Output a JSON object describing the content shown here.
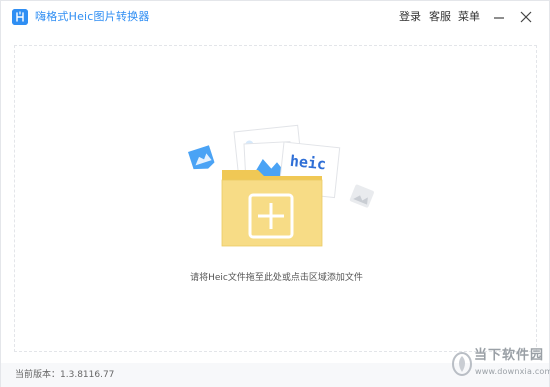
{
  "app": {
    "title": "嗨格式Heic图片转换器",
    "accent_color": "#2f8ef3",
    "logo_icon": "app-logo-icon"
  },
  "menu": {
    "login": "登录",
    "support": "客服",
    "menu": "菜单"
  },
  "window_controls": {
    "minimize_icon": "minimize-icon",
    "close_icon": "close-icon"
  },
  "drop_zone": {
    "hint": "请将Heic文件拖至此处或点击区域添加文件",
    "card_text": "heic",
    "folder_color": "#f5d46f"
  },
  "footer": {
    "version_label": "当前版本：",
    "version_value": "1.3.8116.77"
  },
  "watermark": {
    "line1": "当下软件园",
    "line2": "www.downxia.com"
  }
}
